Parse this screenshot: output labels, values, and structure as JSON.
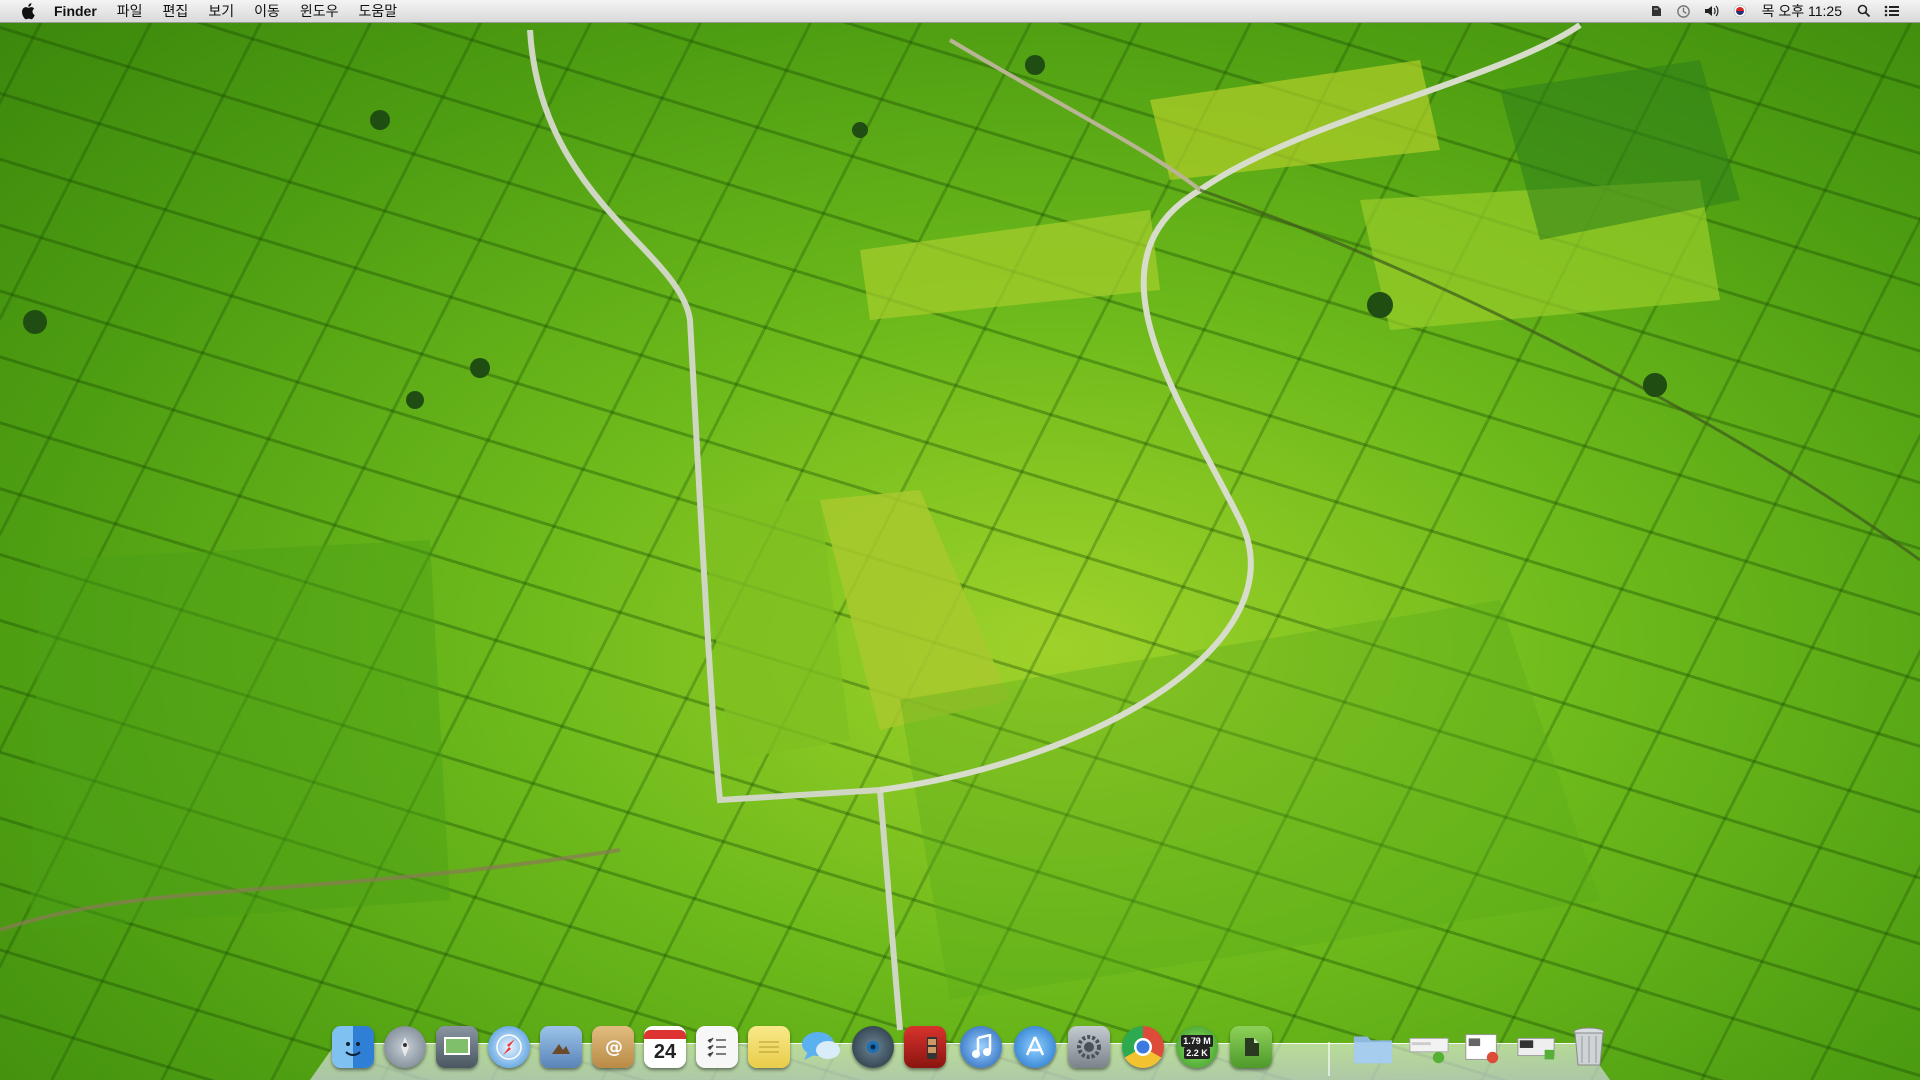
{
  "menubar": {
    "app_name": "Finder",
    "menus": [
      "파일",
      "편집",
      "보기",
      "이동",
      "윈도우",
      "도움말"
    ],
    "clock": "목 오후 11:25",
    "status_icons": [
      "evernote-icon",
      "time-machine-icon",
      "volume-icon",
      "input-source-flag-icon",
      "spotlight-icon",
      "notification-center-icon"
    ]
  },
  "dock": {
    "apps": [
      {
        "name": "finder-icon",
        "color": "#4a90e2"
      },
      {
        "name": "launchpad-icon",
        "color": "#8c9aa8"
      },
      {
        "name": "image-capture-icon",
        "color": "#6b7a86"
      },
      {
        "name": "safari-icon",
        "color": "#3a8fd9"
      },
      {
        "name": "preview-icon",
        "color": "#5a84b8"
      },
      {
        "name": "contacts-icon",
        "color": "#c9a060"
      },
      {
        "name": "calendar-icon",
        "color": "#ffffff"
      },
      {
        "name": "reminders-icon",
        "color": "#f4f4f4"
      },
      {
        "name": "notes-icon",
        "color": "#f3dd6a"
      },
      {
        "name": "messages-icon",
        "color": "#5bb0f0"
      },
      {
        "name": "facetime-icon",
        "color": "#3b4d5a"
      },
      {
        "name": "photo-booth-icon",
        "color": "#b0231f"
      },
      {
        "name": "itunes-icon",
        "color": "#2b78d8"
      },
      {
        "name": "app-store-icon",
        "color": "#2a88e0"
      },
      {
        "name": "system-preferences-icon",
        "color": "#9aa3aa"
      },
      {
        "name": "chrome-icon",
        "color": "#dd4b39"
      },
      {
        "name": "utorrent-icon",
        "color": "#4caf35"
      },
      {
        "name": "evernote-icon",
        "color": "#6bb43a"
      }
    ],
    "calendar_day": "24",
    "utorrent_down": "1.79 M",
    "utorrent_up": "2.2 K",
    "stacks": [
      "applications-folder-icon",
      "downloads-stack-icon",
      "documents-stack-icon",
      "screenshots-stack-icon",
      "trash-icon"
    ]
  }
}
